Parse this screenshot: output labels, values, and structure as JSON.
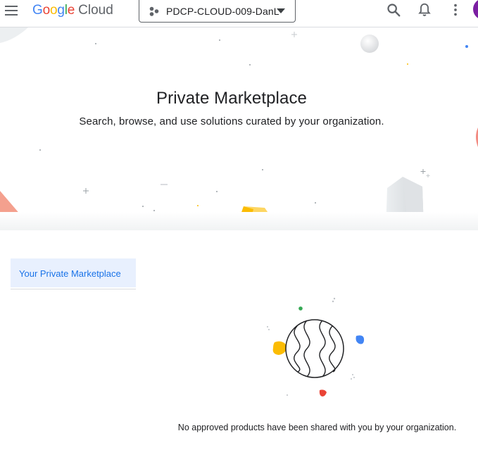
{
  "header": {
    "logo_google": "Google",
    "logo_cloud": "Cloud",
    "project_name": "PDCP-CLOUD-009-DanL",
    "icons": {
      "menu": "menu-icon",
      "project": "project-icon",
      "caret": "caret-down-icon",
      "search": "search-icon",
      "notifications": "bell-icon",
      "more": "more-vert-icon",
      "avatar": "avatar"
    }
  },
  "hero": {
    "title": "Private Marketplace",
    "subtitle": "Search, browse, and use solutions curated by your organization."
  },
  "sidenav": {
    "items": [
      {
        "label": "Your Private Marketplace",
        "selected": true
      }
    ]
  },
  "empty_state": {
    "illustration": "globe-illustration",
    "message": "No approved products have been shared with you by your organization."
  },
  "colors": {
    "accent_blue": "#1a73e8",
    "selected_bg": "#e8f0fe",
    "google_blue": "#4285f4",
    "google_red": "#ea4335",
    "google_yellow": "#fbbc04",
    "google_green": "#34a853",
    "avatar": "#7b1fa2"
  }
}
